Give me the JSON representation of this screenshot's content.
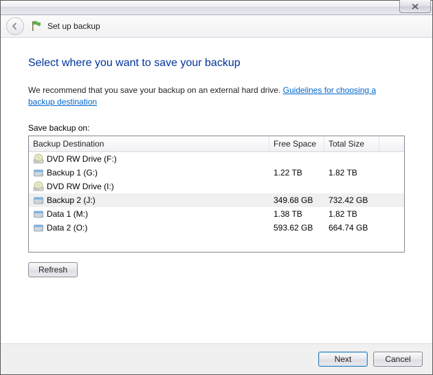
{
  "window": {
    "header_title": "Set up backup"
  },
  "main": {
    "heading": "Select where you want to save your backup",
    "recommend_text": "We recommend that you save your backup on an external hard drive. ",
    "link_text": "Guidelines for choosing a backup destination",
    "list_label": "Save backup on:",
    "columns": {
      "destination": "Backup Destination",
      "free": "Free Space",
      "total": "Total Size"
    },
    "rows": [
      {
        "icon": "dvd",
        "name": "DVD RW Drive (F:)",
        "free": "",
        "total": "",
        "selected": false
      },
      {
        "icon": "hdd",
        "name": "Backup 1 (G:)",
        "free": "1.22 TB",
        "total": "1.82 TB",
        "selected": false
      },
      {
        "icon": "dvd",
        "name": "DVD RW Drive (I:)",
        "free": "",
        "total": "",
        "selected": false
      },
      {
        "icon": "hdd",
        "name": "Backup 2 (J:)",
        "free": "349.68 GB",
        "total": "732.42 GB",
        "selected": true
      },
      {
        "icon": "hdd",
        "name": "Data 1 (M:)",
        "free": "1.38 TB",
        "total": "1.82 TB",
        "selected": false
      },
      {
        "icon": "hdd",
        "name": "Data 2 (O:)",
        "free": "593.62 GB",
        "total": "664.74 GB",
        "selected": false
      }
    ],
    "refresh_label": "Refresh"
  },
  "footer": {
    "next_label": "Next",
    "cancel_label": "Cancel"
  }
}
